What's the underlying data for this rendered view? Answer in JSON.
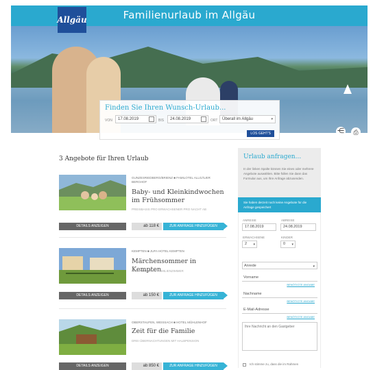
{
  "header": {
    "title": "Familienurlaub im Allgäu",
    "logo_text": "Allgäu"
  },
  "search": {
    "title": "Finden Sie Ihren Wunsch-Urlaub...",
    "from_label": "VON",
    "from_value": "17.08.2019",
    "to_label": "BIS",
    "to_value": "24.08.2019",
    "where_label": "ORT",
    "where_value": "Überall im Allgäu",
    "submit_label": "LOS GEHT'S"
  },
  "offers_heading": "3 Angebote für Ihren Urlaub",
  "offers": [
    {
      "location": "GUNZESRIEDBERG/BRIENZ ■ FAMILOTEL ALLGÄUER BERGHOF",
      "name": "Baby- und Kleinkindwochen im Frühsommer",
      "sub": "PREISBASIS PRO ERWACHSENER PRO NACHT AB",
      "details_label": "DETAILS ANZEIGEN",
      "price": "ab 118 €",
      "add_label": "ZUR ANFRAGE HINZUFÜGEN"
    },
    {
      "location": "KEMPTEN ■ JUFA HOTEL KEMPTEN",
      "name": "Märchensommer in Kempten",
      "sub": "PRO PERSON IM FAMILIENZIMMER",
      "details_label": "DETAILS ANZEIGEN",
      "price": "ab 150 €",
      "add_label": "ZUR ANFRAGE HINZUFÜGEN"
    },
    {
      "location": "OBERSTAUFEN, WEISSACH ■ HOTEL MÜHLENHOF",
      "name": "Zeit für die Familie",
      "sub": "DREI ÜBERNACHTUNGEN MIT HALBPENSION",
      "details_label": "DETAILS ANZEIGEN",
      "price": "ab 850 €",
      "add_label": "ZUR ANFRAGE HINZUFÜGEN"
    }
  ],
  "inquiry": {
    "title": "Urlaub anfragen...",
    "description": "In der linken Spalte können Sie eines oder mehrere Angebote auswählen. Bitte füllen Sie dann das Formular aus, um Ihre Anfrage abzusenden.",
    "banner": "Sie haben derzeit noch keine Angebote für die Anfrage gespeichert",
    "arrival_label": "ANREISE",
    "arrival_value": "17.08.2019",
    "departure_label": "ABREISE",
    "departure_value": "24.08.2019",
    "adults_label": "ERWACHSENE",
    "adults_value": "2",
    "children_label": "KINDER",
    "children_value": "0",
    "salutation": "Anrede",
    "firstname": "Vorname",
    "lastname": "Nachname",
    "email": "E-Mail-Adresse",
    "required_label": "BENÖTIGTE ANGABE",
    "message_placeholder": "Ihre Nachricht an den Gastgeber",
    "consent": "Ich stimme zu, dass die im Rahmen"
  }
}
